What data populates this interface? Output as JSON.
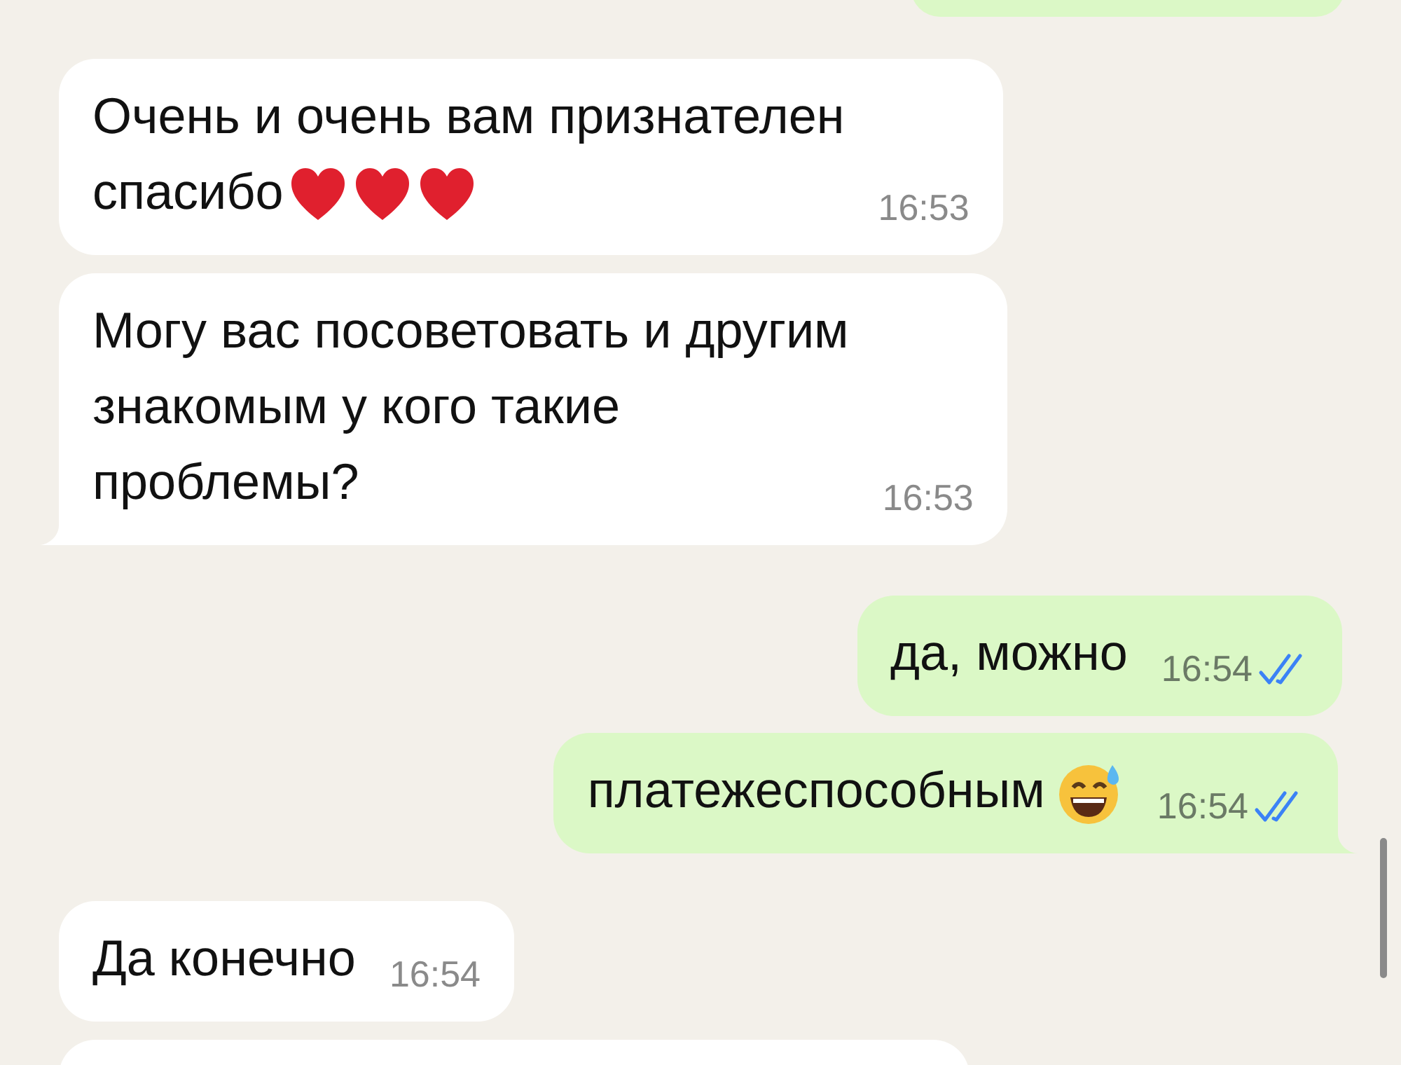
{
  "messages": [
    {
      "kind": "outgoing"
    },
    {
      "kind": "incoming",
      "lines": [
        "Очень и очень вам признателен",
        "спасибо"
      ],
      "icons": [
        {
          "kind": "heart"
        },
        {
          "kind": "heart"
        },
        {
          "kind": "heart"
        }
      ],
      "time": "16:53",
      "tail": false
    },
    {
      "kind": "incoming",
      "lines": [
        "Могу вас посоветовать и другим",
        "знакомым у кого такие",
        "проблемы?"
      ],
      "time": "16:53",
      "tail": true
    },
    {
      "kind": "outgoing",
      "lines": [
        "да, можно"
      ],
      "time": "16:54",
      "read": true,
      "tail": false
    },
    {
      "kind": "outgoing",
      "lines": [
        "платежеспособным"
      ],
      "icons": [
        {
          "kind": "sweat-smile"
        }
      ],
      "time": "16:54",
      "read": true,
      "tail": true
    },
    {
      "kind": "incoming",
      "lines": [
        "Да конечно"
      ],
      "time": "16:54",
      "tail": false
    },
    {
      "kind": "incoming"
    }
  ]
}
